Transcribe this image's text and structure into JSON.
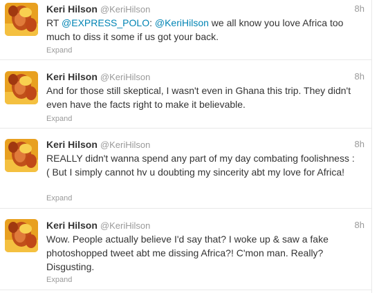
{
  "tweets": [
    {
      "fullname": "Keri Hilson",
      "username": "@KeriHilson",
      "time": "8h",
      "text_prefix": "RT ",
      "mention1": "@EXPRESS_POLO",
      "text_mid": ": ",
      "mention2": "@KeriHilson",
      "text_suffix": " we all know you love Africa too much to diss it some if us got your back.",
      "expand": "Expand"
    },
    {
      "fullname": "Keri Hilson",
      "username": "@KeriHilson",
      "time": "8h",
      "text": "And for those still skeptical, I wasn't even in Ghana this trip. They didn't even have the facts right to make it believable.",
      "expand": "Expand"
    },
    {
      "fullname": "Keri Hilson",
      "username": "@KeriHilson",
      "time": "8h",
      "text": "REALLY didn't wanna spend any part of my day combating foolishness :( But I simply cannot hv u doubting my sincerity abt my love for Africa!",
      "expand": "Expand"
    },
    {
      "fullname": "Keri Hilson",
      "username": "@KeriHilson",
      "time": "8h",
      "text": "Wow. People actually believe I'd say that? I woke up & saw a fake photoshopped tweet abt me dissing Africa?! C'mon man. Really? Disgusting.",
      "expand": "Expand"
    }
  ],
  "colors": {
    "mention": "#0084b4",
    "secondary_text": "#999999",
    "primary_text": "#333333",
    "divider": "#e8e8e8"
  },
  "icons": {
    "avatar": "profile-photo"
  }
}
